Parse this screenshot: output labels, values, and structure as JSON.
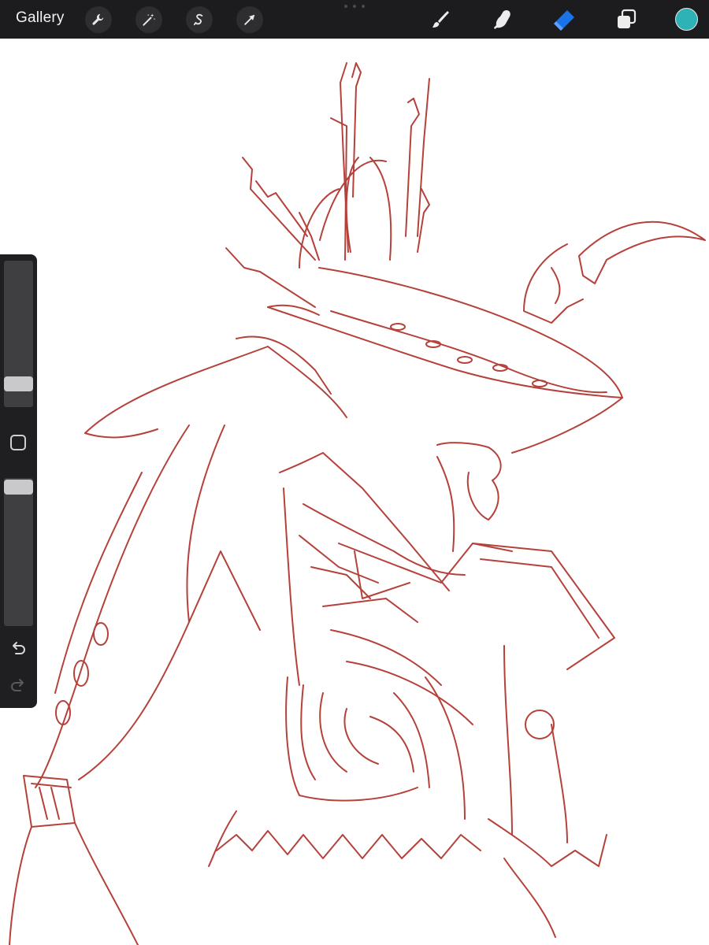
{
  "topbar": {
    "gallery_label": "Gallery",
    "left_tools": [
      {
        "name": "actions",
        "icon": "wrench-icon"
      },
      {
        "name": "adjustments",
        "icon": "magic-wand-icon"
      },
      {
        "name": "selection",
        "icon": "selection-s-icon"
      },
      {
        "name": "transform",
        "icon": "arrow-cursor-icon"
      }
    ],
    "right_tools": [
      {
        "name": "brush",
        "icon": "brush-icon"
      },
      {
        "name": "smudge",
        "icon": "smudge-finger-icon"
      },
      {
        "name": "eraser",
        "icon": "eraser-icon",
        "active": true
      },
      {
        "name": "layers",
        "icon": "layers-icon"
      }
    ],
    "active_color": "#2fb2b6",
    "accent_color": "#1a73e8"
  },
  "canvas": {
    "background": "#ffffff",
    "stroke_color": "#b5413b"
  },
  "sidebar": {
    "brush_size_level": 0.85,
    "opacity_level": 0.05,
    "modify_button": "modify-square-icon",
    "undo_icon": "undo-icon",
    "redo_icon": "redo-icon"
  }
}
